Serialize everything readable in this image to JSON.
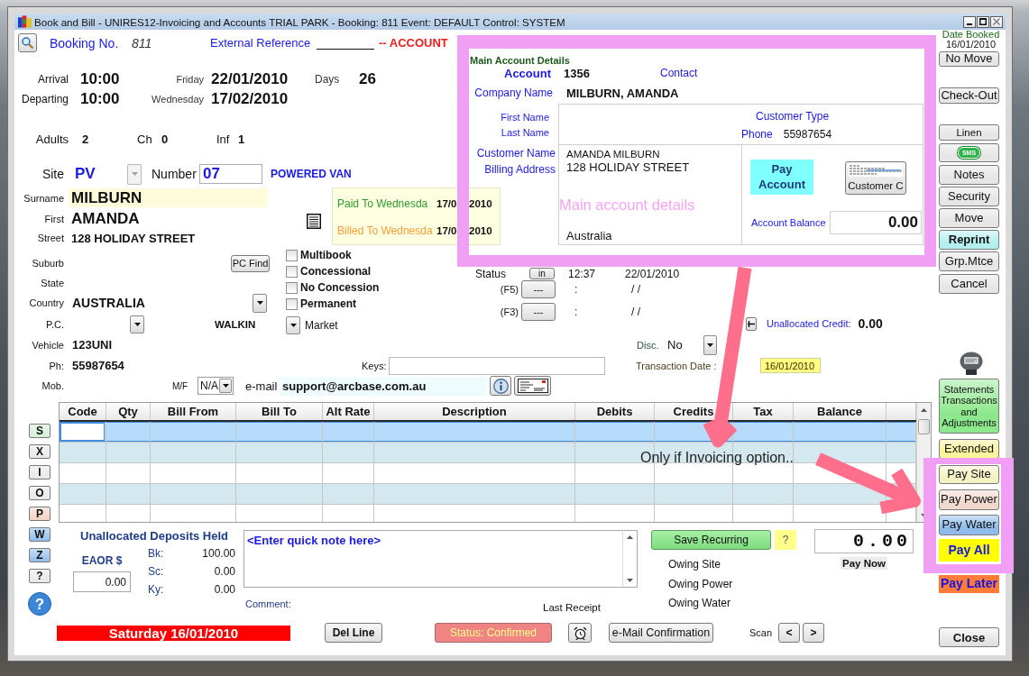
{
  "window": {
    "title": "Book and Bill - UNIRES12-Invoicing and Accounts TRIAL PARK - Booking: 811 Event: DEFAULT Control: SYSTEM"
  },
  "header": {
    "booking_label": "Booking No.",
    "booking_no": "811",
    "external_reference_label": "External Reference",
    "account_banner": "-- ACCOUNT"
  },
  "stay": {
    "rows": [
      {
        "label": "Arrival",
        "time": "10:00",
        "weekday": "Friday",
        "date": "22/01/2010"
      },
      {
        "label": "Departing",
        "time": "10:00",
        "weekday": "Wednesday",
        "date": "17/02/2010"
      }
    ],
    "days_label": "Days",
    "days": "26"
  },
  "guests": [
    {
      "label": "Adults",
      "value": "2"
    },
    {
      "label": "Ch",
      "value": "0"
    },
    {
      "label": "Inf",
      "value": "1"
    }
  ],
  "site": {
    "label": "Site",
    "code": "PV",
    "dropdown_disabled": true,
    "number_label": "Number",
    "number": "07",
    "type": "POWERED VAN"
  },
  "customer": {
    "surname_label": "Surname",
    "surname": "MILBURN",
    "first_label": "First",
    "first": "AMANDA",
    "street_label": "Street",
    "street": "128 HOLIDAY STREET",
    "suburb_label": "Suburb",
    "pc_find_button": "PC Find",
    "state_label": "State",
    "country_label": "Country",
    "country": "AUSTRALIA",
    "pc_label": "P.C.",
    "source": "WALKIN",
    "market_label": "Market",
    "vehicle_label": "Vehicle",
    "vehicle": "123UNI",
    "phone_label": "Ph:",
    "phone": "55987654",
    "mobile_label": "Mob.",
    "gender_label": "M/F",
    "gender": "N/A",
    "email_label": "e-mail",
    "email": "support@arcbase.com.au"
  },
  "paid_to": [
    {
      "label": "Paid To Wednesda",
      "date_start": "17/0",
      "date_end": "2010",
      "color": "#2e9a2e"
    },
    {
      "label": "Billed To Wednesda",
      "date_start": "17/0",
      "date_end": "2010",
      "color": "#ff9c33"
    }
  ],
  "options": [
    {
      "label": "Multibook",
      "checked": false
    },
    {
      "label": "Concessional",
      "checked": false
    },
    {
      "label": "No Concession",
      "checked": false
    },
    {
      "label": "Permanent",
      "checked": false
    }
  ],
  "status": {
    "label": "Status",
    "button": "in",
    "time": "12:37",
    "date": "22/01/2010"
  },
  "events": [
    {
      "key": "(F5)",
      "button": "---",
      "time": ":",
      "date": "/ /"
    },
    {
      "key": "(F3)",
      "button": "---",
      "time": ":",
      "date": "/ /"
    }
  ],
  "unallocated_credit": {
    "label": "Unallocated Credit:",
    "value": "0.00"
  },
  "discount": {
    "label": "Disc.",
    "value": "No"
  },
  "keys": {
    "label": "Keys:"
  },
  "transaction_date": {
    "label": "Transaction Date :",
    "value": "16/01/2010"
  },
  "table": {
    "columns": [
      "Code",
      "Qty",
      "Bill From",
      "Bill To",
      "Alt Rate",
      "Description",
      "Debits",
      "Credits",
      "Tax",
      "Balance"
    ],
    "rows": [
      {
        "selected": true
      },
      {
        "selected": false
      },
      {
        "selected": false
      },
      {
        "selected": false
      },
      {
        "selected": false
      }
    ]
  },
  "letter_buttons": [
    {
      "kind": "key",
      "label": "S",
      "color": "#d3efd3"
    },
    {
      "kind": "key",
      "label": "X",
      "color": "#e8e8e8"
    },
    {
      "kind": "key",
      "label": "I",
      "color": "#e8e8e8"
    },
    {
      "kind": "key",
      "label": "O",
      "color": "#e8e8e8"
    },
    {
      "kind": "key",
      "label": "P",
      "color": "#f3d2c4"
    },
    {
      "kind": "key",
      "label": "W",
      "color": "#8fbdea"
    },
    {
      "kind": "key",
      "label": "Z",
      "color": "#8fbdea"
    },
    {
      "kind": "key",
      "label": "?",
      "color": "#e8e8e8"
    },
    {
      "kind": "round",
      "label": "?",
      "color": "#3b86d6"
    }
  ],
  "deposits": {
    "title": "Unallocated Deposits Held",
    "eaor_label": "EAOR $",
    "eaor_value": "0.00",
    "lines": [
      {
        "label": "Bk:",
        "value": "100.00"
      },
      {
        "label": "Sc:",
        "value": "0.00"
      },
      {
        "label": "Ky:",
        "value": "0.00"
      }
    ]
  },
  "quick_note": {
    "placeholder": "<Enter quick note here>",
    "comment_label": "Comment:",
    "last_receipt_label": "Last Receipt"
  },
  "recurring": {
    "save_button": "Save Recurring",
    "help_button": "?",
    "owing": [
      "Owing Site",
      "Owing Power",
      "Owing Water"
    ]
  },
  "pay_now": {
    "amount": "0.00",
    "label": "Pay Now"
  },
  "footer": {
    "date_banner": "Saturday 16/01/2010",
    "del_line_button": "Del Line",
    "status_button": "Status: Confirmed",
    "email_button": "e-Mail Confirmation",
    "scan_label": "Scan",
    "prev_button": "<",
    "next_button": ">"
  },
  "side_panel": {
    "date_booked_label": "Date Booked",
    "date_booked": "16/01/2010",
    "buttons": [
      {
        "kind": "button",
        "label": "No Move",
        "color": "#e6e6e6"
      },
      {
        "kind": "button",
        "label": "Check-Out",
        "color": "#e6e6e6"
      },
      {
        "kind": "button",
        "label": "Linen",
        "color": "#e6e6e6"
      },
      {
        "kind": "sms",
        "label": "SMS",
        "color": "#e6e6e6"
      },
      {
        "kind": "button",
        "label": "Notes",
        "color": "#e6e6e6"
      },
      {
        "kind": "button",
        "label": "Security",
        "color": "#e6e6e6"
      },
      {
        "kind": "button",
        "label": "Move",
        "color": "#e6e6e6"
      },
      {
        "kind": "bold",
        "label": "Reprint",
        "color": "#b4efef"
      },
      {
        "kind": "button",
        "label": "Grp.Mtce",
        "color": "#e6e6e6"
      },
      {
        "kind": "button",
        "label": "Cancel",
        "color": "#e6e6e6"
      },
      {
        "kind": "device"
      },
      {
        "kind": "button",
        "label": "Statements Transactions and Adjustments",
        "color": "#8de88d"
      },
      {
        "kind": "button",
        "label": "Extended",
        "color": "#f8f49c"
      },
      {
        "kind": "button",
        "label": "Pay Site",
        "color": "#f6f2c4"
      },
      {
        "kind": "button",
        "label": "Pay Power",
        "color": "#f0d8cc"
      },
      {
        "kind": "button",
        "label": "Pay Water",
        "color": "#8fbcec"
      },
      {
        "kind": "flat",
        "label": "Pay All",
        "color": "#ffff00"
      },
      {
        "kind": "flat",
        "label": "Pay Later",
        "color": "#ff7b3a"
      }
    ],
    "close_button": "Close"
  },
  "account_popup": {
    "title": "Main Account Details",
    "account_label": "Account",
    "account": "1356",
    "contact_label": "Contact",
    "company_label": "Company Name",
    "company": "MILBURN, AMANDA",
    "first_name_label": "First Name",
    "last_name_label": "Last Name",
    "customer_type_label": "Customer Type",
    "phone_label": "Phone",
    "phone": "55987654",
    "customer_name_label": "Customer Name",
    "billing_address_label": "Billing Address",
    "billing_lines": [
      "AMANDA MILBURN",
      "128 HOLIDAY STREET"
    ],
    "country": "Australia",
    "pay_account_button": "Pay Account",
    "customer_button": "Customer C",
    "balance_label": "Account Balance",
    "balance": "0.00"
  },
  "annotations": {
    "popup_note": "Main account details",
    "invoicing_note": "Only if Invoicing option.."
  }
}
